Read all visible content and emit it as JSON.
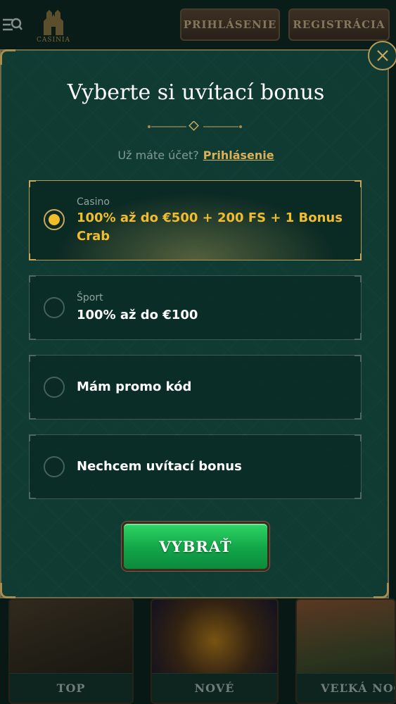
{
  "header": {
    "logo_text": "CASINIA",
    "login_label": "PRIHLÁSENIE",
    "register_label": "REGISTRÁCIA"
  },
  "games": {
    "categories": [
      "TOP",
      "NOVÉ",
      "VEĽKÁ NOC"
    ]
  },
  "modal": {
    "title": "Vyberte si uvítací bonus",
    "account_question": "Už máte účet?",
    "login_link": "Prihlásenie",
    "options": [
      {
        "category": "Casino",
        "text": "100% až do €500 + 200 FS + 1 Bonus Crab",
        "selected": true
      },
      {
        "category": "Šport",
        "text": "100% až do €100",
        "selected": false
      },
      {
        "category": "",
        "text": "Mám promo kód",
        "selected": false
      },
      {
        "category": "",
        "text": "Nechcem uvítací bonus",
        "selected": false
      }
    ],
    "submit_label": "VYBRAŤ"
  },
  "colors": {
    "accent_gold": "#f1bd2c",
    "modal_bg": "#0f3b33",
    "button_green": "#12a548"
  },
  "icons": [
    "menu-search-icon",
    "castle-logo-icon",
    "close-icon",
    "ornament-divider-icon",
    "radio-icon"
  ]
}
